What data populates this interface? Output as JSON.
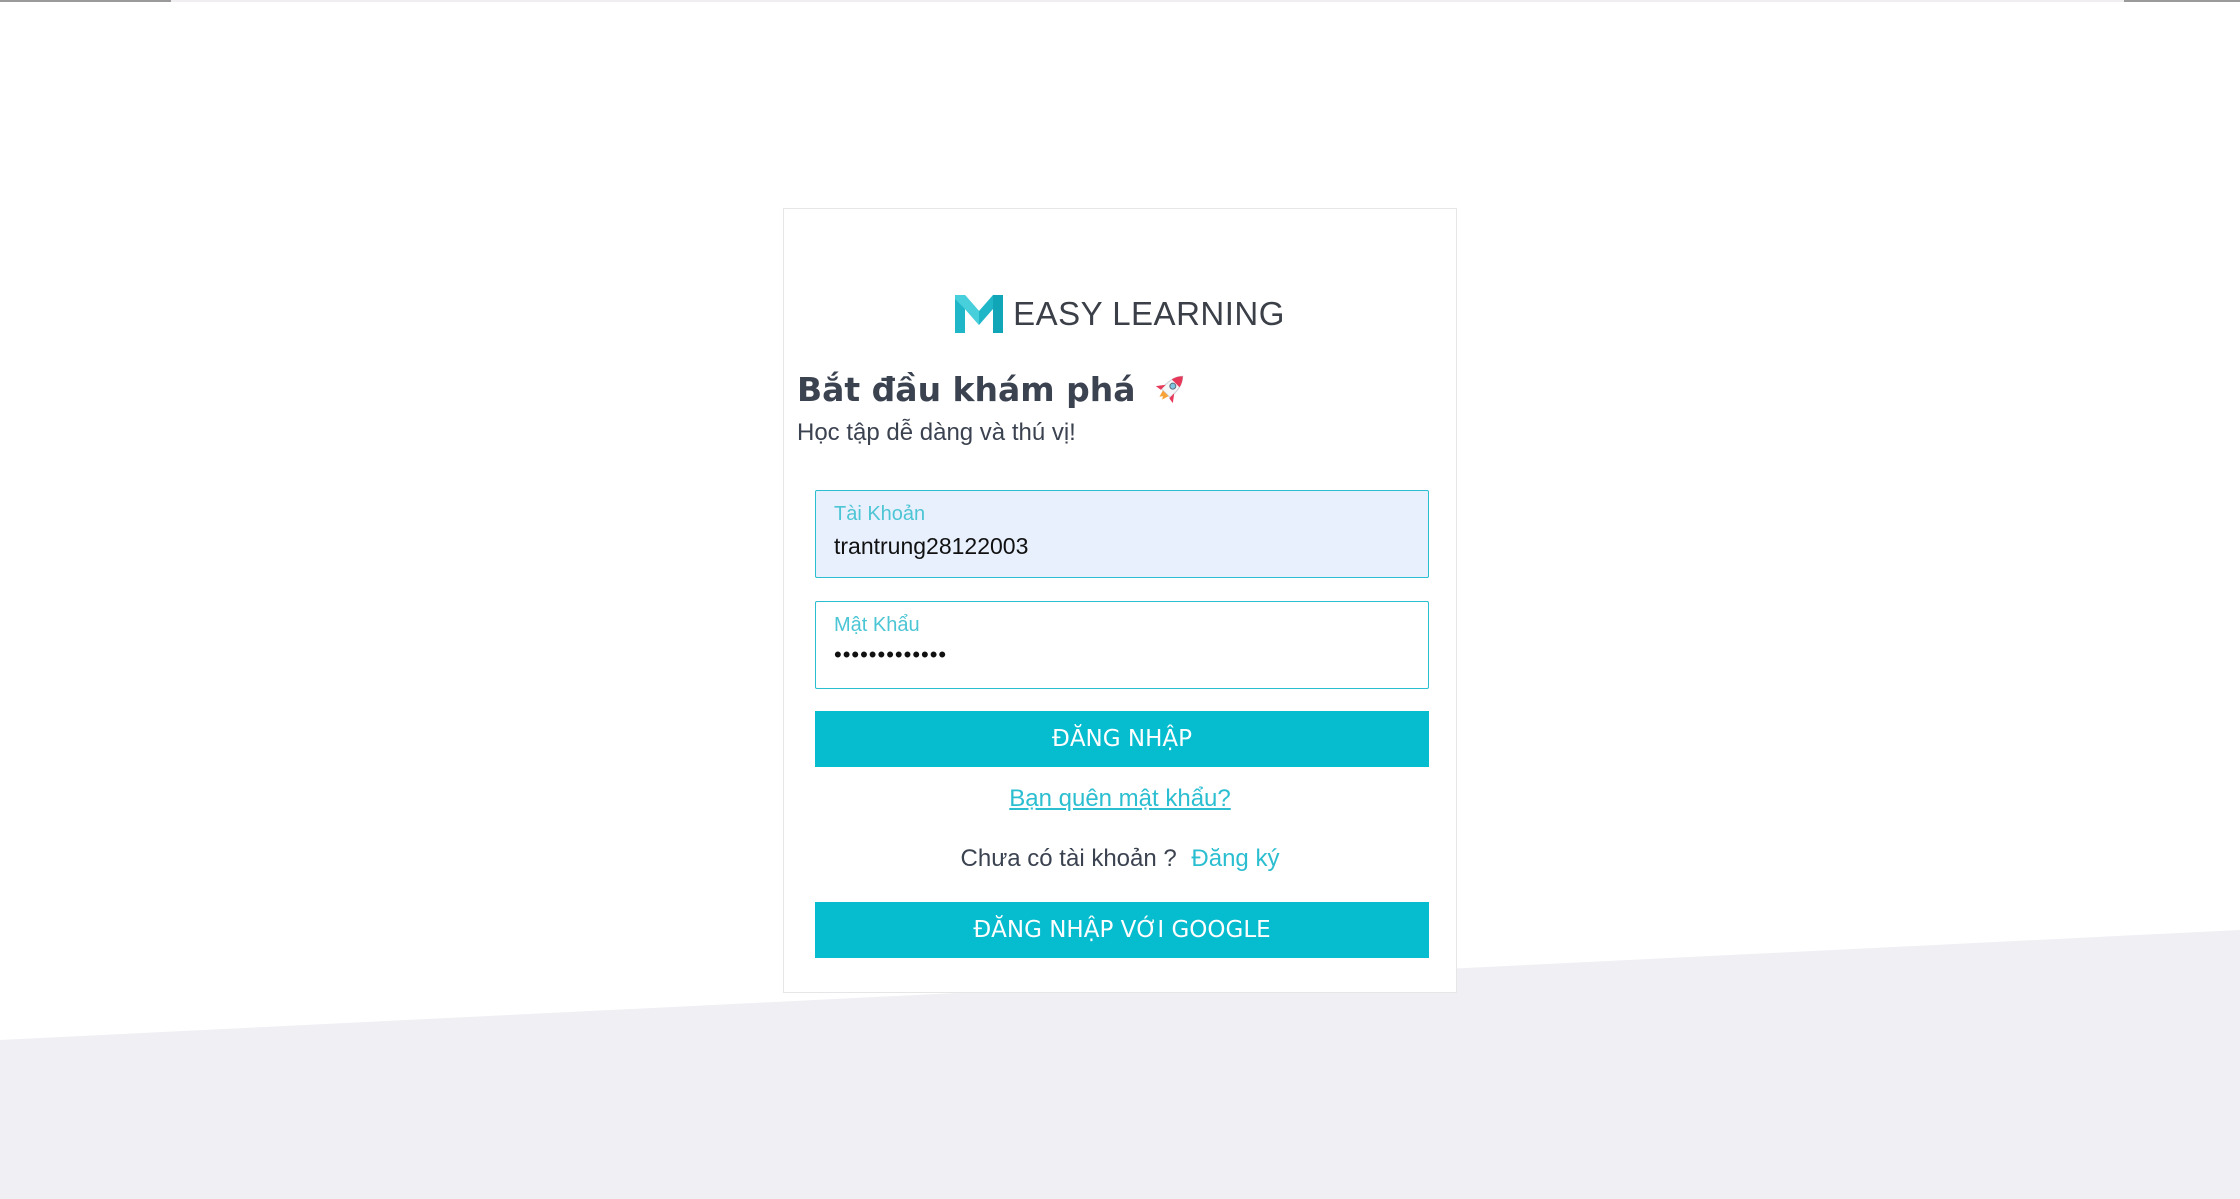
{
  "brand": {
    "name": "EASY LEARNING",
    "logo_icon": "m-logo-icon",
    "accent_color": "#06bccf"
  },
  "login": {
    "heading": "Bắt đầu khám phá",
    "heading_icon": "rocket-icon",
    "subtitle": "Học tập dễ dàng và thú vị!",
    "username": {
      "label": "Tài Khoản",
      "value": "trantrung28122003"
    },
    "password": {
      "label": "Mật Khẩu",
      "value": "•••••••••••••"
    },
    "login_button": "ĐĂNG NHẬP",
    "forgot_link": "Bạn quên mật khẩu?",
    "signup_prompt": "Chưa có tài khoản ?",
    "signup_link": "Đăng ký",
    "google_button": "ĐĂNG NHẬP VỚI GOOGLE"
  },
  "colors": {
    "background_band": "#efeff4",
    "input_border": "#2bbed0",
    "autofill_bg": "#e8f0fe"
  }
}
